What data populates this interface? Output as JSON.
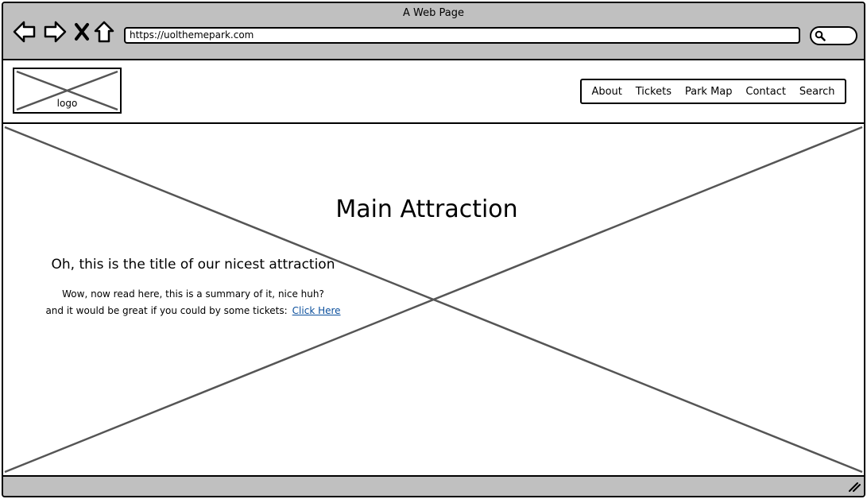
{
  "window": {
    "title": "A Web Page"
  },
  "browser": {
    "url": "https://uolthemepark.com",
    "icons": [
      "back-arrow-icon",
      "forward-arrow-icon",
      "close-x-icon",
      "home-icon",
      "search-icon"
    ]
  },
  "header": {
    "logo_label": "logo",
    "menu": [
      "About",
      "Tickets",
      "Park Map",
      "Contact",
      "Search"
    ]
  },
  "hero": {
    "title": "Main Attraction",
    "attraction_title": "Oh, this is the title of our nicest attraction",
    "summary_line1": "Wow, now read here, this is a summary of it, nice huh?",
    "summary_line2": "and it would be great if you could by some tickets:",
    "link_text": "Click Here"
  },
  "colors": {
    "chrome": "#c0c0c0",
    "link": "#0b4f9c",
    "placeholder_lines": "#555555"
  }
}
